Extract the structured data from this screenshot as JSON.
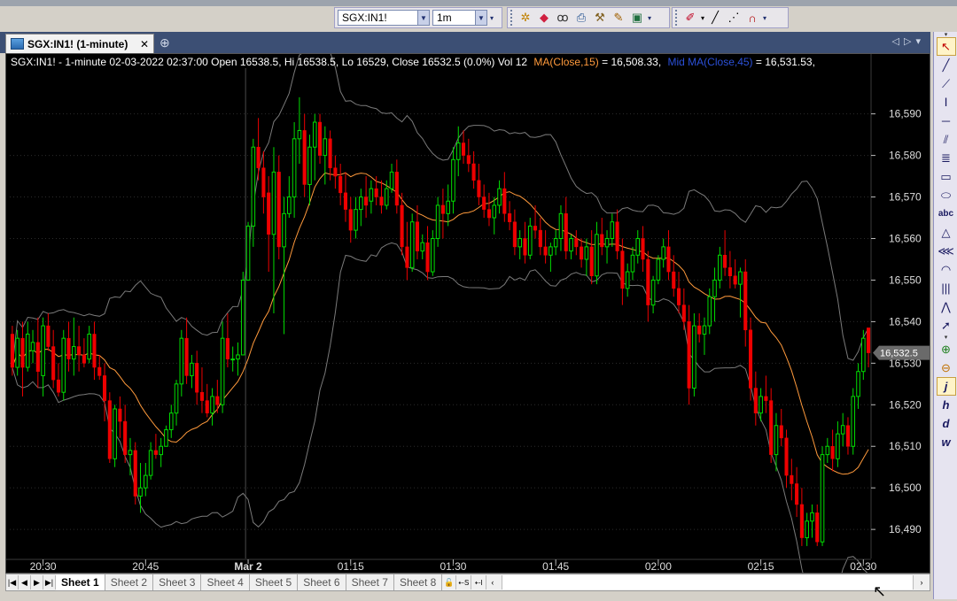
{
  "toolbar": {
    "symbol_value": "SGX:IN1!",
    "interval_value": "1m"
  },
  "document_tab": {
    "title": "SGX:IN1! (1-minute)",
    "close_glyph": "✕",
    "add_glyph": "⊕"
  },
  "chart_header": {
    "base": "SGX:IN1! - 1-minute 02-03-2022 02:37:00 Open 16538.5, Hi 16538.5, Lo 16529, Close 16532.5 (0.0%) Vol 12",
    "ma_text": "MA(Close,15)",
    "ma_value": " = 16,508.33,",
    "mid_text": "Mid MA(Close,45)",
    "mid_value": " = 16,531.53,",
    "colors": {
      "base": "#ffffff",
      "ma": "#ff9a3c",
      "mid": "#2b50d8"
    }
  },
  "chart_data": {
    "type": "candlestick",
    "symbol": "SGX:IN1!",
    "interval": "1-minute",
    "ylim": [
      16483,
      16601
    ],
    "y_ticks": [
      16490,
      16500,
      16510,
      16520,
      16530,
      16540,
      16550,
      16560,
      16570,
      16580,
      16590
    ],
    "y_tick_labels": [
      "16,490",
      "16,500",
      "16,510",
      "16,520",
      "16,530",
      "16,540",
      "16,550",
      "16,560",
      "16,570",
      "16,580",
      "16,590"
    ],
    "x_ticks": [
      {
        "label": "20:30",
        "bar": 6
      },
      {
        "label": "20:45",
        "bar": 26
      },
      {
        "label": "Mar 2",
        "bar": 46,
        "bold": true
      },
      {
        "label": "01:15",
        "bar": 66
      },
      {
        "label": "01:30",
        "bar": 86
      },
      {
        "label": "01:45",
        "bar": 106
      },
      {
        "label": "02:00",
        "bar": 126
      },
      {
        "label": "02:15",
        "bar": 146
      },
      {
        "label": "02:30",
        "bar": 166
      }
    ],
    "separator_bar": 45.5,
    "last_price": 16532.5,
    "last_price_label": "16,532.5",
    "colors": {
      "up": "#00dd00",
      "down": "#ee0000",
      "ma": "#ff9a3c",
      "bands": "#7a7a7a",
      "background": "#000000",
      "grid": "#2c2c2c"
    },
    "candles": [
      [
        16537,
        16539,
        16527,
        16529
      ],
      [
        16529,
        16538,
        16527,
        16536
      ],
      [
        16536,
        16540,
        16522,
        16529
      ],
      [
        16529,
        16540,
        16528,
        16537
      ],
      [
        16533,
        16538,
        16530,
        16535
      ],
      [
        16535,
        16541,
        16524,
        16528
      ],
      [
        16527,
        16541,
        16522,
        16539
      ],
      [
        16539,
        16542,
        16533,
        16534
      ],
      [
        16534,
        16538,
        16524,
        16526
      ],
      [
        16526,
        16530,
        16522,
        16523
      ],
      [
        16523,
        16538,
        16521,
        16536
      ],
      [
        16536,
        16540,
        16528,
        16531
      ],
      [
        16531,
        16541,
        16527,
        16534
      ],
      [
        16534,
        16539,
        16528,
        16532
      ],
      [
        16532,
        16536,
        16529,
        16530
      ],
      [
        16531,
        16539,
        16530,
        16537
      ],
      [
        16537,
        16540,
        16526,
        16529
      ],
      [
        16529,
        16532,
        16526,
        16527
      ],
      [
        16527,
        16530,
        16516,
        16521
      ],
      [
        16521,
        16523,
        16506,
        16507
      ],
      [
        16507,
        16520,
        16505,
        16519
      ],
      [
        16519,
        16522,
        16512,
        16516
      ],
      [
        16516,
        16520,
        16506,
        16508
      ],
      [
        16508,
        16512,
        16503,
        16509
      ],
      [
        16509,
        16511,
        16496,
        16498
      ],
      [
        16498,
        16506,
        16494,
        16500
      ],
      [
        16500,
        16506,
        16498,
        16503
      ],
      [
        16503,
        16511,
        16502,
        16509
      ],
      [
        16509,
        16513,
        16507,
        16508
      ],
      [
        16508,
        16512,
        16505,
        16510
      ],
      [
        16510,
        16515,
        16510,
        16514
      ],
      [
        16514,
        16520,
        16512,
        16518
      ],
      [
        16518,
        16526,
        16515,
        16525
      ],
      [
        16525,
        16538,
        16522,
        16536
      ],
      [
        16536,
        16541,
        16525,
        16527
      ],
      [
        16527,
        16532,
        16524,
        16530
      ],
      [
        16530,
        16533,
        16520,
        16523
      ],
      [
        16523,
        16529,
        16518,
        16521
      ],
      [
        16521,
        16525,
        16517,
        16518
      ],
      [
        16518,
        16524,
        16515,
        16522
      ],
      [
        16522,
        16526,
        16518,
        16520
      ],
      [
        16520,
        16540,
        16518,
        16536
      ],
      [
        16536,
        16542,
        16529,
        16531
      ],
      [
        16531,
        16534,
        16528,
        16531
      ],
      [
        16531,
        16535,
        16527,
        16532
      ],
      [
        16532,
        16552,
        16532,
        16550
      ],
      [
        16550,
        16564,
        16550,
        16563
      ],
      [
        16563,
        16584,
        16558,
        16582
      ],
      [
        16582,
        16589,
        16574,
        16577
      ],
      [
        16577,
        16581,
        16566,
        16570
      ],
      [
        16571,
        16575,
        16552,
        16561
      ],
      [
        16561,
        16582,
        16542,
        16576
      ],
      [
        16576,
        16580,
        16555,
        16558
      ],
      [
        16558,
        16570,
        16537,
        16566
      ],
      [
        16566,
        16575,
        16565,
        16570
      ],
      [
        16570,
        16588,
        16565,
        16584
      ],
      [
        16584,
        16594,
        16578,
        16586
      ],
      [
        16586,
        16590,
        16570,
        16573
      ],
      [
        16573,
        16585,
        16568,
        16582
      ],
      [
        16582,
        16590,
        16574,
        16588
      ],
      [
        16588,
        16590,
        16578,
        16580
      ],
      [
        16580,
        16587,
        16573,
        16584
      ],
      [
        16584,
        16586,
        16574,
        16577
      ],
      [
        16577,
        16580,
        16572,
        16575
      ],
      [
        16575,
        16578,
        16568,
        16571
      ],
      [
        16571,
        16576,
        16564,
        16567
      ],
      [
        16567,
        16570,
        16559,
        16562
      ],
      [
        16562,
        16570,
        16560,
        16567
      ],
      [
        16567,
        16572,
        16563,
        16570
      ],
      [
        16570,
        16575,
        16565,
        16568
      ],
      [
        16569,
        16574,
        16566,
        16572
      ],
      [
        16572,
        16575,
        16568,
        16570
      ],
      [
        16570,
        16574,
        16566,
        16568
      ],
      [
        16568,
        16574,
        16567,
        16572
      ],
      [
        16572,
        16578,
        16571,
        16576
      ],
      [
        16576,
        16579,
        16566,
        16568
      ],
      [
        16568,
        16571,
        16556,
        16558
      ],
      [
        16558,
        16564,
        16550,
        16553
      ],
      [
        16553,
        16566,
        16552,
        16564
      ],
      [
        16564,
        16568,
        16555,
        16557
      ],
      [
        16557,
        16561,
        16555,
        16559
      ],
      [
        16559,
        16563,
        16550,
        16552
      ],
      [
        16552,
        16562,
        16551,
        16560
      ],
      [
        16560,
        16570,
        16558,
        16568
      ],
      [
        16568,
        16572,
        16560,
        16566
      ],
      [
        16566,
        16573,
        16563,
        16569
      ],
      [
        16569,
        16582,
        16566,
        16579
      ],
      [
        16579,
        16587,
        16575,
        16583
      ],
      [
        16583,
        16586,
        16578,
        16580
      ],
      [
        16580,
        16584,
        16576,
        16578
      ],
      [
        16578,
        16581,
        16572,
        16574
      ],
      [
        16574,
        16578,
        16568,
        16570
      ],
      [
        16570,
        16573,
        16565,
        16567
      ],
      [
        16567,
        16571,
        16563,
        16565
      ],
      [
        16565,
        16570,
        16561,
        16568
      ],
      [
        16568,
        16574,
        16566,
        16572
      ],
      [
        16572,
        16576,
        16564,
        16566
      ],
      [
        16566,
        16569,
        16562,
        16564
      ],
      [
        16564,
        16567,
        16556,
        16558
      ],
      [
        16558,
        16562,
        16555,
        16560
      ],
      [
        16560,
        16564,
        16554,
        16556
      ],
      [
        16556,
        16565,
        16555,
        16563
      ],
      [
        16563,
        16568,
        16560,
        16562
      ],
      [
        16562,
        16565,
        16556,
        16558
      ],
      [
        16558,
        16562,
        16554,
        16556
      ],
      [
        16556,
        16559,
        16552,
        16558
      ],
      [
        16558,
        16562,
        16556,
        16560
      ],
      [
        16560,
        16568,
        16557,
        16566
      ],
      [
        16566,
        16570,
        16555,
        16557
      ],
      [
        16557,
        16561,
        16555,
        16560
      ],
      [
        16560,
        16562,
        16556,
        16558
      ],
      [
        16558,
        16560,
        16553,
        16555
      ],
      [
        16555,
        16560,
        16551,
        16558
      ],
      [
        16558,
        16562,
        16549,
        16551
      ],
      [
        16551,
        16564,
        16549,
        16561
      ],
      [
        16561,
        16565,
        16556,
        16558
      ],
      [
        16558,
        16562,
        16554,
        16560
      ],
      [
        16560,
        16566,
        16558,
        16564
      ],
      [
        16564,
        16567,
        16555,
        16557
      ],
      [
        16557,
        16560,
        16544,
        16548
      ],
      [
        16548,
        16554,
        16546,
        16552
      ],
      [
        16552,
        16558,
        16550,
        16556
      ],
      [
        16556,
        16562,
        16554,
        16560
      ],
      [
        16560,
        16563,
        16552,
        16555
      ],
      [
        16555,
        16557,
        16540,
        16544
      ],
      [
        16544,
        16551,
        16542,
        16550
      ],
      [
        16550,
        16556,
        16549,
        16555
      ],
      [
        16555,
        16560,
        16553,
        16558
      ],
      [
        16558,
        16562,
        16550,
        16552
      ],
      [
        16552,
        16556,
        16546,
        16548
      ],
      [
        16548,
        16552,
        16542,
        16544
      ],
      [
        16544,
        16548,
        16538,
        16540
      ],
      [
        16540,
        16544,
        16520,
        16524
      ],
      [
        16524,
        16542,
        16522,
        16539
      ],
      [
        16539,
        16542,
        16535,
        16537
      ],
      [
        16537,
        16541,
        16532,
        16539
      ],
      [
        16539,
        16548,
        16537,
        16546
      ],
      [
        16546,
        16553,
        16540,
        16550
      ],
      [
        16550,
        16558,
        16548,
        16556
      ],
      [
        16556,
        16562,
        16551,
        16553
      ],
      [
        16553,
        16557,
        16548,
        16551
      ],
      [
        16551,
        16555,
        16548,
        16549
      ],
      [
        16549,
        16553,
        16541,
        16552
      ],
      [
        16552,
        16555,
        16534,
        16538
      ],
      [
        16538,
        16541,
        16521,
        16524
      ],
      [
        16524,
        16528,
        16515,
        16518
      ],
      [
        16518,
        16524,
        16516,
        16522
      ],
      [
        16522,
        16527,
        16518,
        16521
      ],
      [
        16521,
        16524,
        16506,
        16508
      ],
      [
        16508,
        16518,
        16504,
        16515
      ],
      [
        16515,
        16519,
        16510,
        16512
      ],
      [
        16512,
        16514,
        16500,
        16503
      ],
      [
        16503,
        16507,
        16497,
        16501
      ],
      [
        16501,
        16505,
        16493,
        16496
      ],
      [
        16496,
        16500,
        16486,
        16488
      ],
      [
        16488,
        16494,
        16486,
        16492
      ],
      [
        16492,
        16496,
        16488,
        16494
      ],
      [
        16494,
        16496,
        16486,
        16487
      ],
      [
        16487,
        16510,
        16486,
        16508
      ],
      [
        16508,
        16512,
        16506,
        16510
      ],
      [
        16510,
        16514,
        16504,
        16507
      ],
      [
        16507,
        16516,
        16505,
        16513
      ],
      [
        16513,
        16518,
        16510,
        16515
      ],
      [
        16515,
        16517,
        16508,
        16510
      ],
      [
        16510,
        16524,
        16508,
        16522
      ],
      [
        16522,
        16530,
        16519,
        16528
      ],
      [
        16528,
        16538,
        16526,
        16536
      ],
      [
        16538.5,
        16538.5,
        16529,
        16532.5
      ]
    ]
  },
  "sheets": [
    "Sheet 1",
    "Sheet 2",
    "Sheet 3",
    "Sheet 4",
    "Sheet 5",
    "Sheet 6",
    "Sheet 7",
    "Sheet 8"
  ],
  "side_tools": [
    {
      "name": "pointer-icon",
      "glyph": "↖"
    },
    {
      "name": "trendline-icon",
      "glyph": "╱"
    },
    {
      "name": "ray-icon",
      "glyph": "⟋"
    },
    {
      "name": "vertical-line-icon",
      "glyph": "Ⅰ"
    },
    {
      "name": "horizontal-line-icon",
      "glyph": "─"
    },
    {
      "name": "parallel-lines-icon",
      "glyph": "⫽"
    },
    {
      "name": "fibonacci-icon",
      "glyph": "≣"
    },
    {
      "name": "rectangle-icon",
      "glyph": "▭"
    },
    {
      "name": "ellipse-icon",
      "glyph": "⬭"
    },
    {
      "name": "text-icon",
      "glyph": "abc"
    },
    {
      "name": "triangle-icon",
      "glyph": "△"
    },
    {
      "name": "andrews-pitchfork-icon",
      "glyph": "⋘"
    },
    {
      "name": "arc-icon",
      "glyph": "◠"
    },
    {
      "name": "cycle-lines-icon",
      "glyph": "|||"
    },
    {
      "name": "zigzag-icon",
      "glyph": "⋀"
    },
    {
      "name": "arrow-icon",
      "glyph": "➚"
    },
    {
      "name": "zoom-in-icon",
      "glyph": "⊕"
    },
    {
      "name": "zoom-out-icon",
      "glyph": "⊖"
    },
    {
      "name": "interval-j-icon",
      "glyph": "j"
    },
    {
      "name": "interval-h-icon",
      "glyph": "h"
    },
    {
      "name": "interval-d-icon",
      "glyph": "d"
    },
    {
      "name": "interval-w-icon",
      "glyph": "w"
    }
  ]
}
